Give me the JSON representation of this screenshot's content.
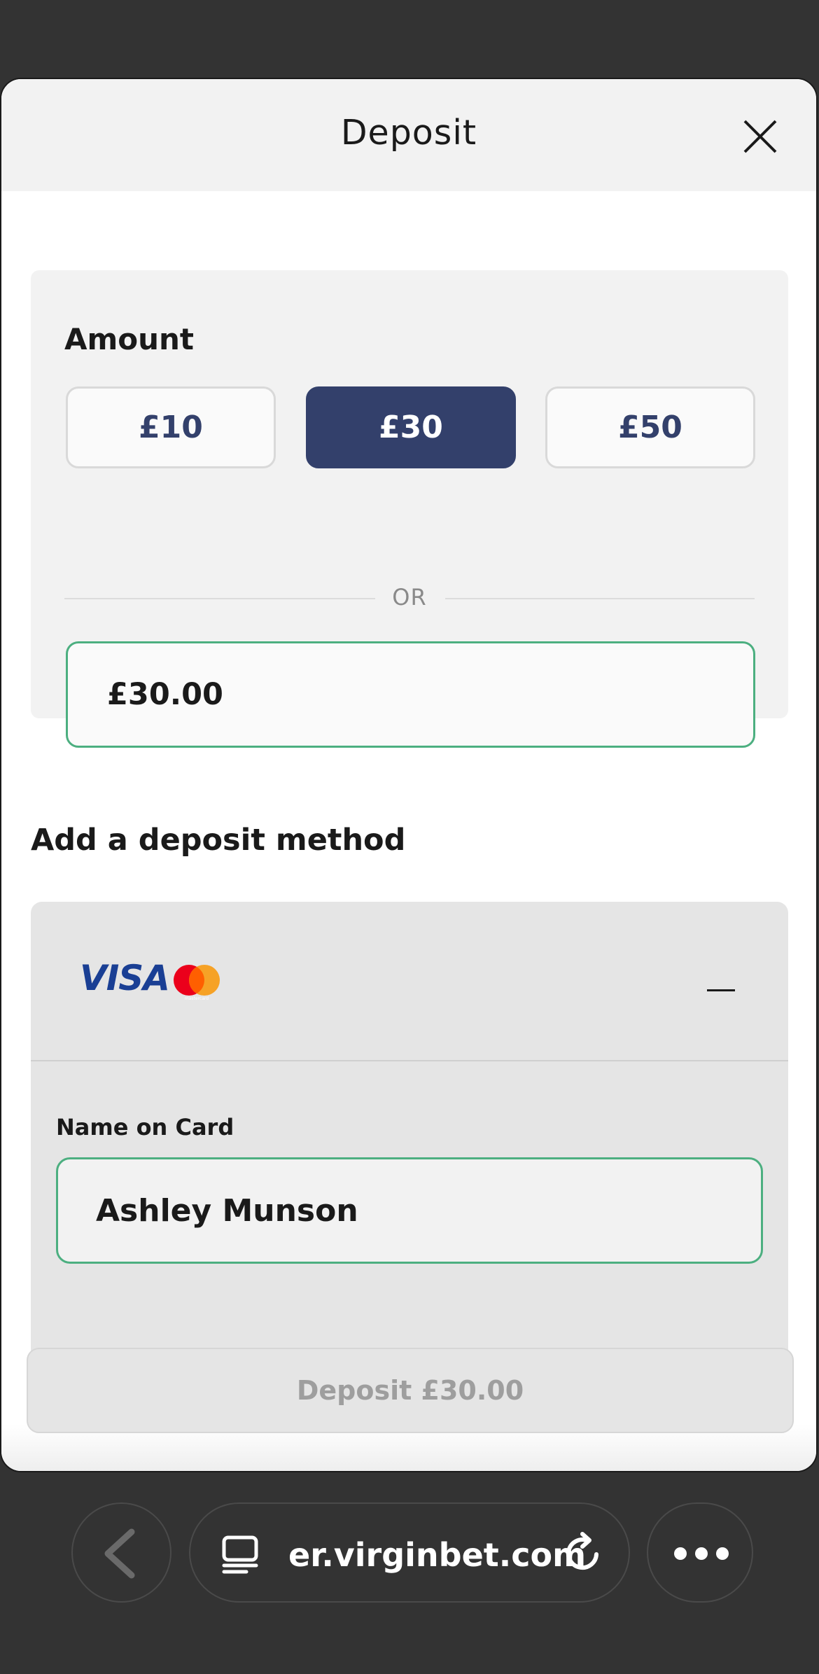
{
  "modal": {
    "title": "Deposit"
  },
  "amount": {
    "label": "Amount",
    "chips": [
      {
        "label": "£10",
        "selected": false
      },
      {
        "label": "£30",
        "selected": true
      },
      {
        "label": "£50",
        "selected": false
      }
    ],
    "or_text": "OR",
    "input_value": "£30.00"
  },
  "deposit_method": {
    "heading": "Add a deposit method",
    "card_brands": [
      "VISA",
      "mastercard"
    ],
    "name_label": "Name on Card",
    "name_value": "Ashley Munson"
  },
  "footer": {
    "deposit_label": "Deposit £30.00"
  },
  "browser": {
    "url": "er.virginbet.com"
  },
  "colors": {
    "primary": "#33406b",
    "focus_border": "#4caf80",
    "visa_blue": "#1a3f94",
    "mc_red": "#eb001b",
    "mc_orange": "#f79e1b"
  }
}
